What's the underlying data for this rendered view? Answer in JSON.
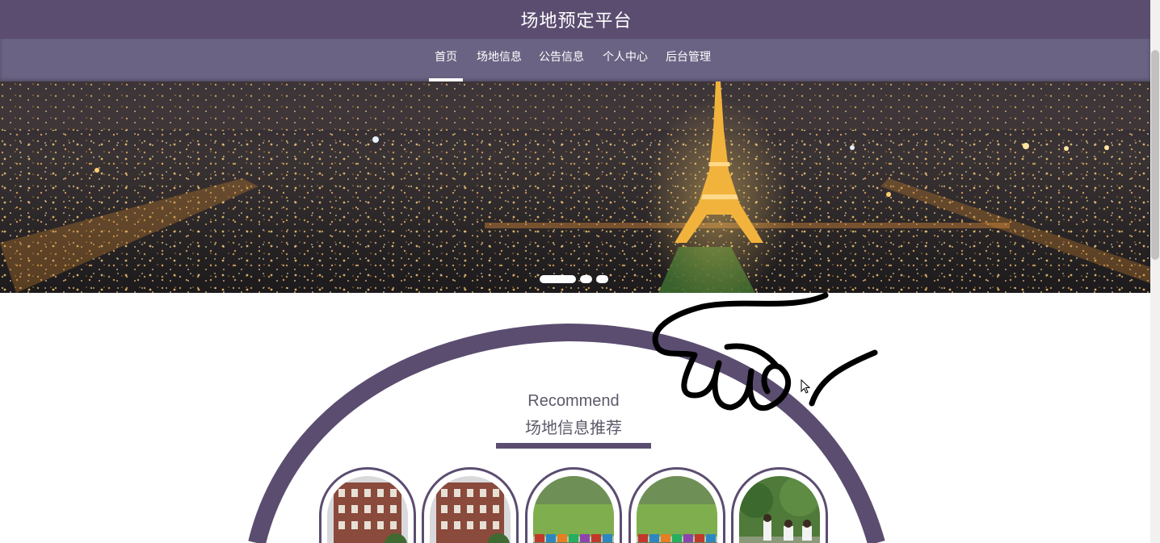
{
  "header": {
    "title": "场地预定平台"
  },
  "nav": {
    "items": [
      {
        "label": "首页",
        "active": true
      },
      {
        "label": "场地信息",
        "active": false
      },
      {
        "label": "公告信息",
        "active": false
      },
      {
        "label": "个人中心",
        "active": false
      },
      {
        "label": "后台管理",
        "active": false
      }
    ]
  },
  "banner": {
    "slides": 3,
    "active_slide": 1
  },
  "recommend": {
    "title_en": "Recommend",
    "title_cn": "场地信息推荐",
    "cards": [
      {
        "image": "building-photo"
      },
      {
        "image": "building-photo"
      },
      {
        "image": "field-photo"
      },
      {
        "image": "field-photo"
      },
      {
        "image": "people-photo"
      }
    ]
  },
  "colors": {
    "primary": "#5b4d70",
    "nav": "#6a6383",
    "text": "#5b5b6b"
  }
}
